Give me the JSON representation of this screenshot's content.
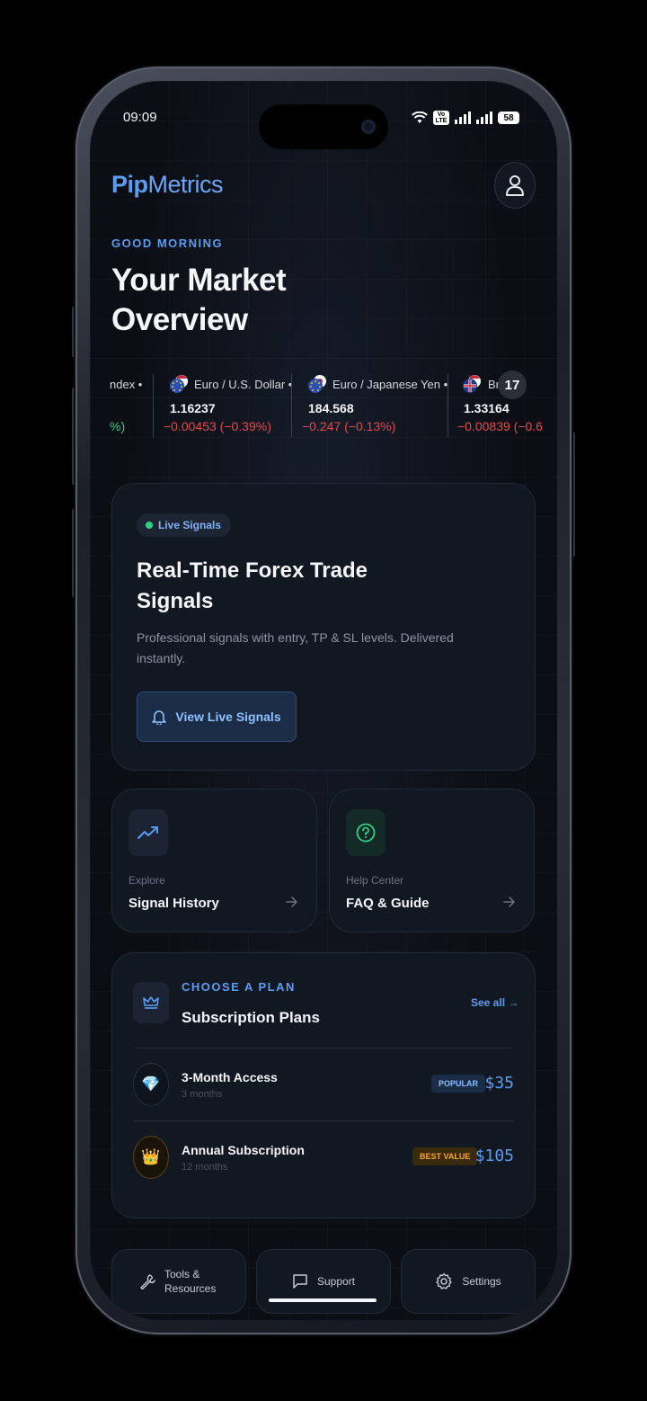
{
  "status_bar": {
    "time": "09:09",
    "volte": "Vo LTE",
    "battery": "58"
  },
  "header": {
    "logo_pip": "Pip",
    "logo_metrics": "Metrics"
  },
  "greeting": "GOOD MORNING",
  "headline": "Your Market Overview",
  "ticker": {
    "items": [
      {
        "name": "ndex •",
        "price": "",
        "change": "%)",
        "change_color": "#2ecf86"
      },
      {
        "name": "Euro / U.S. Dollar •",
        "price": "1.16237",
        "change": "−0.00453 (−0.39%)",
        "change_color": "#e5484d"
      },
      {
        "name": "Euro / Japanese Yen •",
        "price": "184.568",
        "change": "−0.247 (−0.13%)",
        "change_color": "#e5484d"
      },
      {
        "name": "Br       ou",
        "price": "1.33164",
        "change": "−0.00839 (−0.6",
        "change_color": "#e5484d"
      }
    ],
    "badge": "17"
  },
  "signals_card": {
    "pill": "Live Signals",
    "title": "Real-Time Forex Trade Signals",
    "description": "Professional signals with entry, TP & SL levels. Delivered instantly.",
    "button": "View Live Signals"
  },
  "quick_cards": [
    {
      "eyebrow": "Explore",
      "title": "Signal History"
    },
    {
      "eyebrow": "Help Center",
      "title": "FAQ & Guide"
    }
  ],
  "plans": {
    "eyebrow": "CHOOSE A PLAN",
    "title": "Subscription Plans",
    "see_all": "See all →",
    "items": [
      {
        "name": "3-Month Access",
        "duration": "3 months",
        "badge": "POPULAR",
        "price": "$35",
        "icon": "💎"
      },
      {
        "name": "Annual Subscription",
        "duration": "12 months",
        "badge": "BEST VALUE",
        "price": "$105",
        "icon": "👑"
      }
    ]
  },
  "bottom_nav": [
    {
      "label": "Tools & Resources"
    },
    {
      "label": "Support"
    },
    {
      "label": "Settings"
    }
  ],
  "colors": {
    "accent": "#5b9cf2",
    "positive": "#2ecf86",
    "negative": "#e5484d",
    "gold": "#f0a928"
  }
}
